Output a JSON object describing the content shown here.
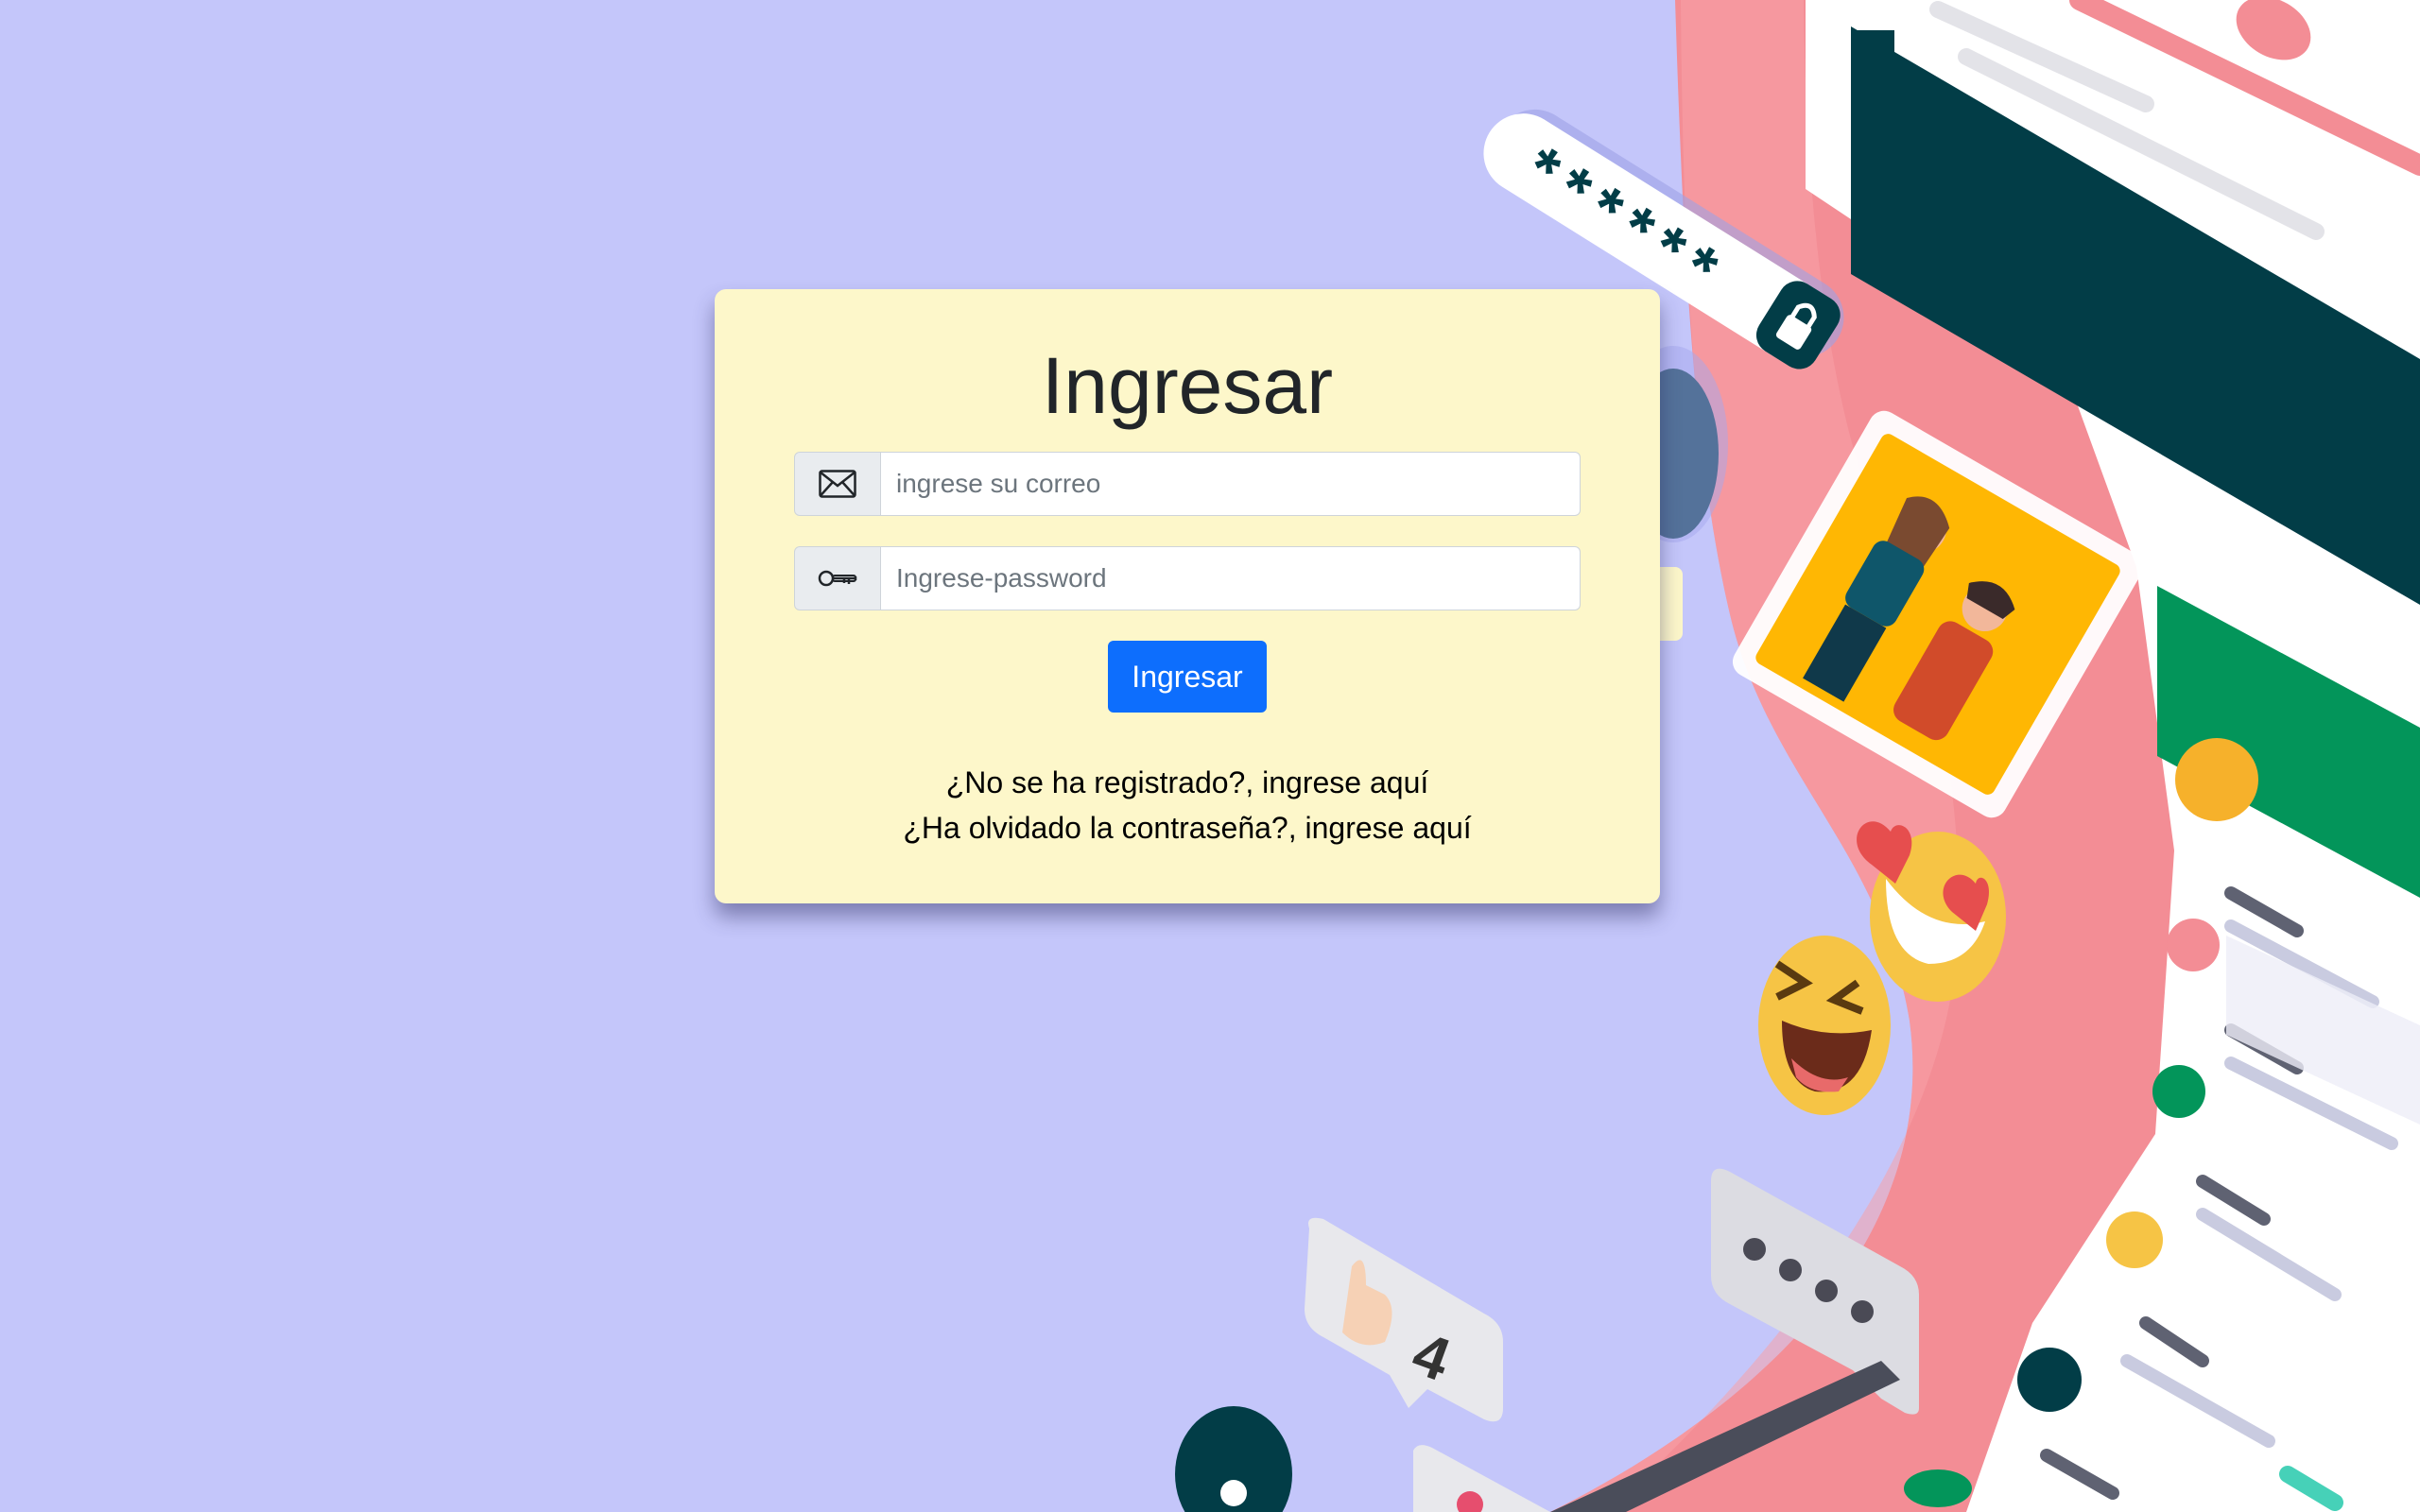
{
  "page": {
    "background_color": "#c4c6fa",
    "card_color": "#fdf7ca",
    "accent_color": "#0d6efd"
  },
  "login": {
    "title": "Ingresar",
    "email": {
      "icon": "envelope-icon",
      "placeholder": "ingrese su correo",
      "value": ""
    },
    "password": {
      "icon": "key-icon",
      "placeholder": "Ingrese-password",
      "value": ""
    },
    "submit_label": "Ingresar",
    "register_link": "¿No se ha registrado?, ingrese aquí",
    "forgot_link": "¿Ha olvidado la contraseña?, ingrese aquí"
  },
  "illustration": {
    "password_mask": "******",
    "like_count": "4",
    "icons": [
      "lock-icon",
      "thumbs-up-icon",
      "heart-eyes-emoji",
      "laughing-emoji",
      "chat-bubble-icon"
    ]
  }
}
